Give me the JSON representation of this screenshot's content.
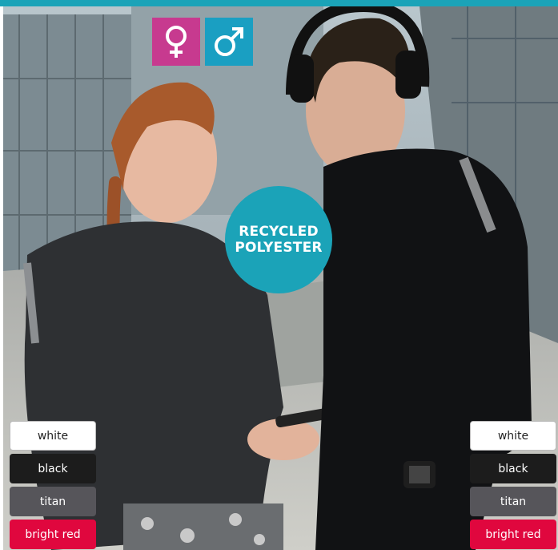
{
  "header": {
    "accent_color": "#1ba3b8"
  },
  "gender_icons": [
    {
      "name": "female-symbol",
      "color": "#c73a8f"
    },
    {
      "name": "male-symbol",
      "color": "#1a9fc2"
    }
  ],
  "badge": {
    "line1": "RECYCLED",
    "line2": "POLYESTER",
    "color": "#1ba3b8"
  },
  "swatches_left": [
    {
      "label": "white",
      "color": "#ffffff"
    },
    {
      "label": "black",
      "color": "#1c1c1c"
    },
    {
      "label": "titan",
      "color": "#56555a"
    },
    {
      "label": "bright red",
      "color": "#e0073e"
    }
  ],
  "swatches_right": [
    {
      "label": "white",
      "color": "#ffffff"
    },
    {
      "label": "black",
      "color": "#1c1c1c"
    },
    {
      "label": "titan",
      "color": "#56555a"
    },
    {
      "label": "bright red",
      "color": "#e0073e"
    }
  ]
}
